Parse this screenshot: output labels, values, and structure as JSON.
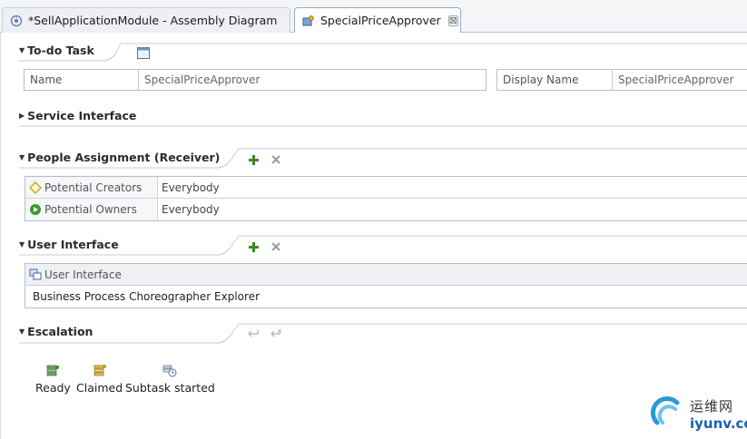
{
  "tabs": [
    {
      "label": "*SellApplicationModule - Assembly Diagram",
      "icon": "assembly-diagram-icon",
      "active": false
    },
    {
      "label": "SpecialPriceApprover",
      "icon": "human-task-icon",
      "active": true,
      "close": "⊠"
    }
  ],
  "todo": {
    "title": "To-do Task",
    "name_label": "Name",
    "name_value": "SpecialPriceApprover",
    "display_label": "Display Name",
    "display_value": "SpecialPriceApprover"
  },
  "service_interface": {
    "title": "Service Interface"
  },
  "people": {
    "title": "People Assignment (Receiver)",
    "rows": [
      {
        "role": "Potential Creators",
        "value": "Everybody",
        "icon": "potential-creators-icon"
      },
      {
        "role": "Potential Owners",
        "value": "Everybody",
        "icon": "potential-owners-icon"
      }
    ]
  },
  "user_interface": {
    "title": "User Interface",
    "column": "User Interface",
    "rows": [
      "Business Process Choreographer Explorer"
    ]
  },
  "escalation": {
    "title": "Escalation",
    "items": [
      {
        "label": "Ready",
        "icon": "ready-state-icon"
      },
      {
        "label": "Claimed",
        "icon": "claimed-state-icon"
      },
      {
        "label": "Subtask started",
        "icon": "subtask-started-icon"
      }
    ]
  },
  "watermark": {
    "cn": "运维网",
    "url": "iyunv.com"
  },
  "colors": {
    "accent_green": "#3b8a1f",
    "delete_gray": "#9aa0a8",
    "border": "#c8cdd6"
  }
}
